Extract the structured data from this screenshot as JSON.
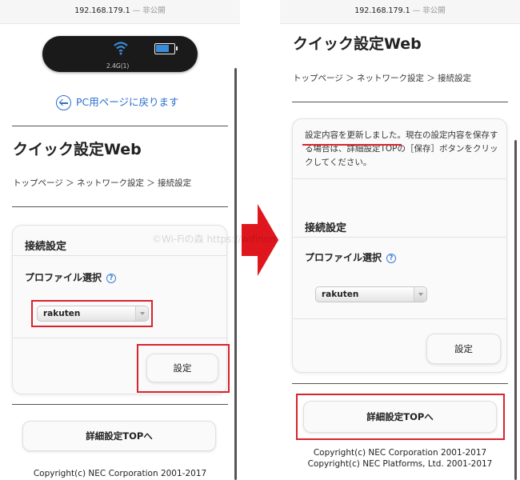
{
  "left": {
    "url": {
      "address": "192.168.179.1",
      "separator": "—",
      "status": "非公開"
    },
    "device": {
      "band": "2.4G(1)",
      "battery_level": 0.75,
      "wifi_icon": "wifi-icon",
      "battery_icon": "battery-icon"
    },
    "back_link": {
      "label": "PC用ページに戻ります",
      "icon": "back-arrow-icon"
    },
    "title": "クイック設定Web",
    "breadcrumb": "トップページ ＞ ネットワーク設定 ＞ 接続設定",
    "card": {
      "heading": "接続設定",
      "profile_label": "プロファイル選択",
      "help_icon": "help-icon",
      "help_glyph": "?",
      "select_value": "rakuten",
      "submit_label": "設定"
    },
    "top_button_label": "詳細設定TOPへ",
    "copyright": "Copyright(c) NEC Corporation 2001-2017"
  },
  "right": {
    "url": {
      "address": "192.168.179.1",
      "separator": "—",
      "status": "非公開"
    },
    "title": "クイック設定Web",
    "breadcrumb": "トップページ ＞ ネットワーク設定 ＞ 接続設定",
    "message": {
      "highlight": "設定内容を更新しました。",
      "rest": "現在の設定内容を保存する場合は、詳細設定TOPの［保存］ボタンをクリックしてください。"
    },
    "card": {
      "heading": "接続設定",
      "profile_label": "プロファイル選択",
      "help_icon": "help-icon",
      "help_glyph": "?",
      "select_value": "rakuten",
      "submit_label": "設定"
    },
    "top_button_label": "詳細設定TOPへ",
    "copyright": [
      "Copyright(c) NEC Corporation 2001-2017",
      "Copyright(c) NEC Platforms, Ltd. 2001-2017"
    ]
  },
  "watermark": "©Wi-Fiの森 https://wifinomori.com",
  "colors": {
    "highlight_red": "#d9232d",
    "link_blue": "#2a6fd0",
    "arrow_red": "#e0161e"
  }
}
